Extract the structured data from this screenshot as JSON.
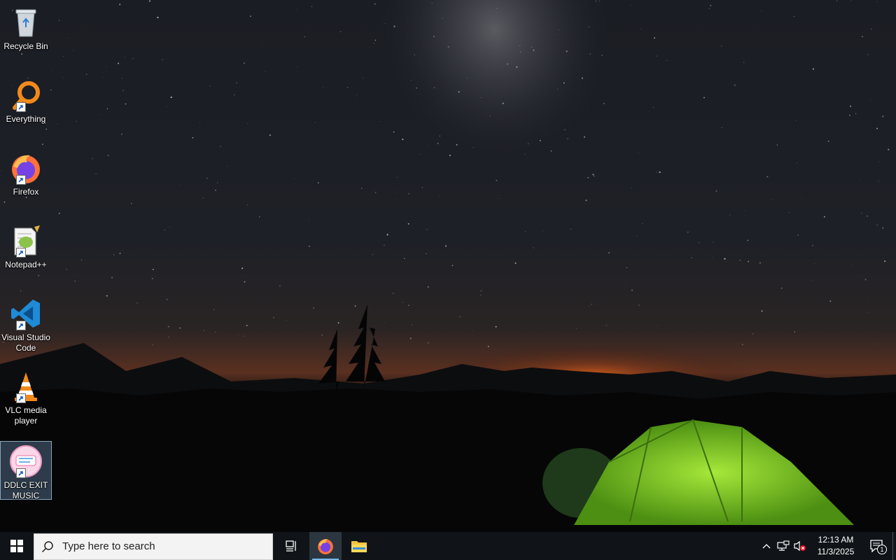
{
  "desktop": {
    "icons": [
      {
        "label": "Recycle Bin",
        "icon": "recycle-bin-icon",
        "shortcut": false
      },
      {
        "label": "Everything",
        "icon": "everything-search-icon",
        "shortcut": true
      },
      {
        "label": "Firefox",
        "icon": "firefox-icon",
        "shortcut": true
      },
      {
        "label": "Notepad++",
        "icon": "notepad-plus-plus-icon",
        "shortcut": true
      },
      {
        "label": "Visual Studio Code",
        "icon": "vscode-icon",
        "shortcut": true
      },
      {
        "label": "VLC media player",
        "icon": "vlc-icon",
        "shortcut": true
      },
      {
        "label": "DDLC EXIT MUSIC",
        "icon": "ddlc-exit-music-icon",
        "shortcut": true,
        "selected": true
      }
    ]
  },
  "taskbar": {
    "search_placeholder": "Type here to search",
    "clock": {
      "time": "12:13 AM",
      "date": "11/3/2025"
    },
    "notification_count": "1",
    "colors": {
      "taskbar_bg": "#101418",
      "active_indicator": "#76b9ed"
    }
  }
}
